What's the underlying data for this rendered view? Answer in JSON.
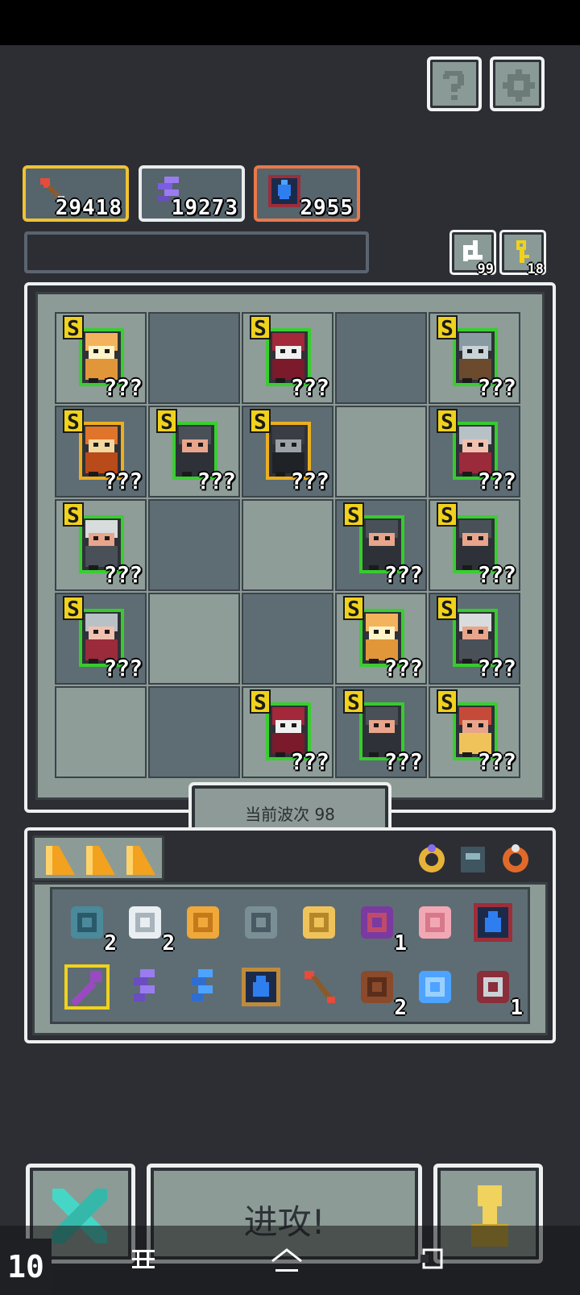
{
  "resources": [
    {
      "icon": "arrow-icon",
      "value": "29418"
    },
    {
      "icon": "crystal-icon",
      "value": "19273"
    },
    {
      "icon": "mana-tome-icon",
      "value": "2955"
    }
  ],
  "small_buttons": {
    "refresh_count": "99",
    "key_count": "18"
  },
  "board": {
    "wave_label": "当前波次 98",
    "units": [
      {
        "rank": "S",
        "hidden": "???",
        "icon": "ogre-icon"
      },
      {
        "rank": "S",
        "hidden": "???",
        "icon": "red-mage-icon"
      },
      {
        "rank": "S",
        "hidden": "???",
        "icon": "shield-knight-icon"
      },
      {
        "rank": "S",
        "hidden": "???",
        "icon": "viking-icon"
      },
      {
        "rank": "S",
        "hidden": "???",
        "icon": "dwarf-icon"
      },
      {
        "rank": "S",
        "hidden": "???",
        "icon": "black-knight-icon"
      },
      {
        "rank": "S",
        "hidden": "???",
        "icon": "elf-icon"
      },
      {
        "rank": "S",
        "hidden": "???",
        "icon": "old-wizard-icon"
      },
      {
        "rank": "S",
        "hidden": "???",
        "icon": "dwarf-icon"
      },
      {
        "rank": "S",
        "hidden": "???",
        "icon": "dwarf-icon"
      },
      {
        "rank": "S",
        "hidden": "???",
        "icon": "elf-icon"
      },
      {
        "rank": "S",
        "hidden": "???",
        "icon": "ogre-icon"
      },
      {
        "rank": "S",
        "hidden": "???",
        "icon": "old-wizard-icon"
      },
      {
        "rank": "S",
        "hidden": "???",
        "icon": "red-mage-icon"
      },
      {
        "rank": "S",
        "hidden": "???",
        "icon": "dwarf-icon"
      },
      {
        "rank": "S",
        "hidden": "???",
        "icon": "bandit-icon"
      }
    ]
  },
  "inventory": {
    "items": [
      {
        "icon": "heart-gem-icon",
        "count": "2"
      },
      {
        "icon": "scroll-icon",
        "count": "2"
      },
      {
        "icon": "key-icon",
        "count": ""
      },
      {
        "icon": "shuriken-icon",
        "count": ""
      },
      {
        "icon": "crown-icon",
        "count": ""
      },
      {
        "icon": "dragon-head-icon",
        "count": "1"
      },
      {
        "icon": "piggy-bank-icon",
        "count": ""
      },
      {
        "icon": "mana-tome-icon",
        "count": ""
      },
      {
        "icon": "magic-staff-icon",
        "count": ""
      },
      {
        "icon": "purple-crystal-icon",
        "count": ""
      },
      {
        "icon": "blue-crystal-icon",
        "count": ""
      },
      {
        "icon": "water-tome-icon",
        "count": ""
      },
      {
        "icon": "arrow-icon",
        "count": ""
      },
      {
        "icon": "wooden-totem-icon",
        "count": "2"
      },
      {
        "icon": "blue-dragon-icon",
        "count": ""
      },
      {
        "icon": "anchor-icon",
        "count": "1"
      }
    ]
  },
  "bottom": {
    "attack_label": "进攻!",
    "speed_label": "10"
  },
  "colors": {
    "rank_badge": "#f0d21c",
    "board_light": "#8e9d98",
    "board_dark": "#5e6d74",
    "glow_green": "#35d12a",
    "glow_gold": "#f2b31a",
    "frame": "#eef0f0"
  }
}
